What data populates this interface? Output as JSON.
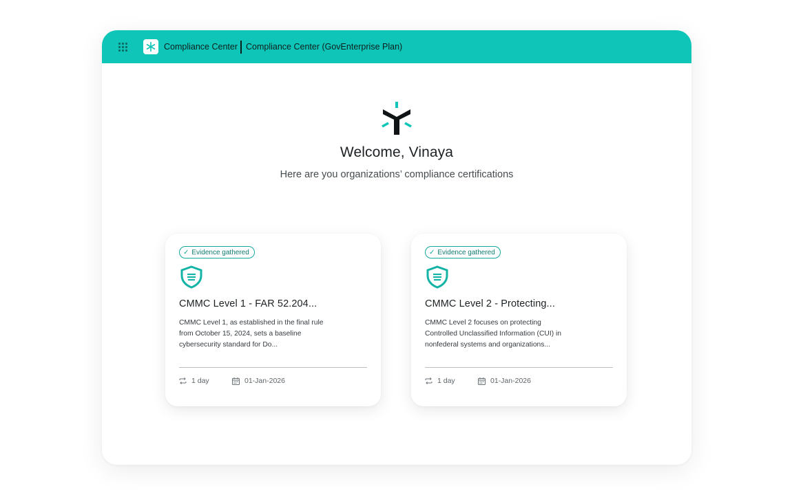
{
  "header": {
    "app_name": "Compliance Center",
    "plan_name": "Compliance Center (GovEnterprise Plan)",
    "icons": [
      "apps-grid-icon",
      "brand-logo-icon"
    ]
  },
  "welcome": {
    "title": "Welcome, Vinaya",
    "subtitle": "Here are you organizations’ compliance certifications"
  },
  "cards": [
    {
      "badge": "Evidence gathered",
      "title": "CMMC Level 1 - FAR 52.204...",
      "description": "CMMC Level 1, as established in the final rule from October 15, 2024, sets a baseline cybersecurity standard for Do...",
      "frequency": "1 day",
      "date": "01-Jan-2026"
    },
    {
      "badge": "Evidence gathered",
      "title": "CMMC Level 2 - Protecting...",
      "description": "CMMC Level 2 focuses on protecting Controlled Unclassified Information (CUI) in nonfederal systems and organizations...",
      "frequency": "1 day",
      "date": "01-Jan-2026"
    }
  ],
  "colors": {
    "accent": "#0fc5b8",
    "badge_border": "#13a89c",
    "text_dark": "#1c2124"
  }
}
